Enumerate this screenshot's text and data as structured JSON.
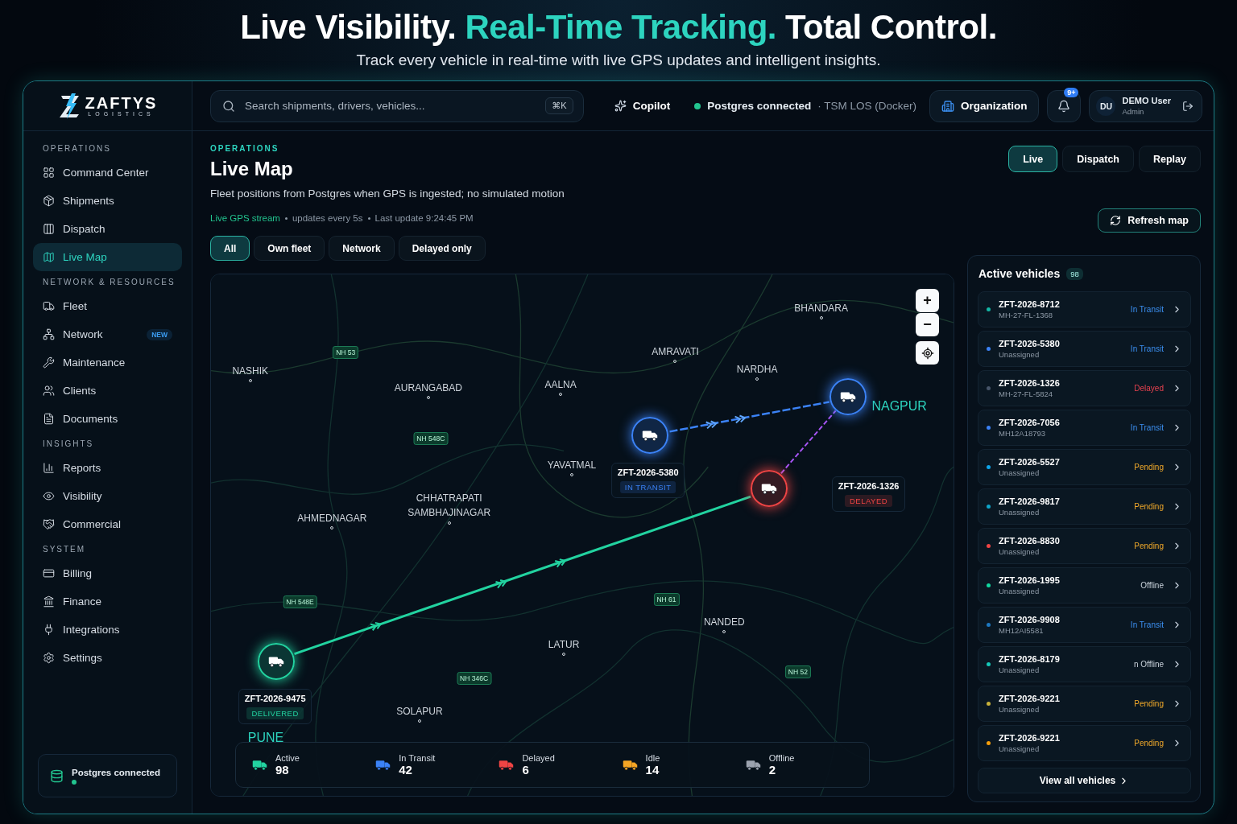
{
  "hero": {
    "headline": [
      {
        "text": "Live Visibility.",
        "highlight": false
      },
      {
        "text": "Real-Time Tracking.",
        "highlight": true
      },
      {
        "text": "Total Control.",
        "highlight": false
      }
    ],
    "subtitle": "Track every vehicle in real-time with live GPS updates and intelligent insights."
  },
  "brand": {
    "name": "ZAFTYS",
    "tagline": "LOGISTICS"
  },
  "sidebar": {
    "sections": [
      {
        "title": "OPERATIONS",
        "items": [
          {
            "label": "Command Center",
            "selected": false
          },
          {
            "label": "Shipments",
            "selected": false
          },
          {
            "label": "Dispatch",
            "selected": false
          },
          {
            "label": "Live Map",
            "selected": true
          }
        ]
      },
      {
        "title": "NETWORK & RESOURCES",
        "items": [
          {
            "label": "Fleet",
            "selected": false
          },
          {
            "label": "Network",
            "selected": false,
            "badge": "NEW"
          },
          {
            "label": "Maintenance",
            "selected": false
          },
          {
            "label": "Clients",
            "selected": false
          },
          {
            "label": "Documents",
            "selected": false
          }
        ]
      },
      {
        "title": "INSIGHTS",
        "items": [
          {
            "label": "Reports",
            "selected": false
          },
          {
            "label": "Visibility",
            "selected": false
          },
          {
            "label": "Commercial",
            "selected": false
          }
        ]
      },
      {
        "title": "SYSTEM",
        "items": [
          {
            "label": "Billing",
            "selected": false
          },
          {
            "label": "Finance",
            "selected": false
          },
          {
            "label": "Integrations",
            "selected": false
          },
          {
            "label": "Settings",
            "selected": false
          }
        ]
      }
    ],
    "footer": {
      "label": "Postgres connected",
      "online": true
    }
  },
  "top_bar": {
    "search": {
      "placeholder": "Search shipments, drivers, vehicles...",
      "shortcut": "⌘K"
    },
    "copilot": "Copilot",
    "db_status": {
      "label": "Postgres connected",
      "detail": "· TSM LOS (Docker)",
      "connected": true
    },
    "organization": "Organization",
    "notifications": "9+",
    "user": {
      "initials": "DU",
      "name": "DEMO User",
      "role": "Admin"
    }
  },
  "page": {
    "eyebrow": "OPERATIONS",
    "title": "Live Map",
    "description": "Fleet positions from Postgres when GPS is ingested; no simulated motion",
    "stream": {
      "label": "Live GPS stream",
      "interval": "updates every 5s",
      "last_update": "Last update 9:24:45 PM"
    },
    "filters": [
      {
        "label": "All",
        "selected": true
      },
      {
        "label": "Own fleet",
        "selected": false
      },
      {
        "label": "Network",
        "selected": false
      },
      {
        "label": "Delayed only",
        "selected": false
      }
    ],
    "modes": [
      {
        "label": "Live",
        "selected": true
      },
      {
        "label": "Dispatch",
        "selected": false
      },
      {
        "label": "Replay",
        "selected": false
      }
    ],
    "refresh": "Refresh map"
  },
  "map": {
    "zoom_in": "+",
    "zoom_out": "−",
    "cities": [
      {
        "name": "BHANDARA",
        "kind": "town"
      },
      {
        "name": "AMRAVATI",
        "kind": "town"
      },
      {
        "name": "NARDHA",
        "kind": "town"
      },
      {
        "name": "AALNA",
        "kind": "town"
      },
      {
        "name": "AURANGABAD",
        "kind": "town"
      },
      {
        "name": "NASHIK",
        "kind": "town"
      },
      {
        "name": "YAVATMAL",
        "kind": "town"
      },
      {
        "name": "CHHATRAPATI SAMBHAJINAGAR",
        "kind": "town"
      },
      {
        "name": "AHMEDNAGAR",
        "kind": "town"
      },
      {
        "name": "NANDED",
        "kind": "town"
      },
      {
        "name": "LATUR",
        "kind": "town"
      },
      {
        "name": "SOLAPUR",
        "kind": "town"
      },
      {
        "name": "NAGPUR",
        "kind": "hub"
      },
      {
        "name": "PUNE",
        "kind": "hub"
      }
    ],
    "roads": [
      "NH 53",
      "NH 548C",
      "NH 548E",
      "NH 61",
      "NH 346C",
      "NH 52"
    ],
    "vehicles": [
      {
        "kind": "in_transit"
      },
      {
        "id": "ZFT-2026-5380",
        "status": "IN TRANSIT",
        "kind": "in_transit"
      },
      {
        "id": "ZFT-2026-1326",
        "status": "DELAYED",
        "kind": "delayed"
      },
      {
        "id": "ZFT-2026-9475",
        "status": "DELIVERED",
        "kind": "delivered"
      }
    ],
    "stats": [
      {
        "label": "Active",
        "value": "98",
        "color": "#22d3a0"
      },
      {
        "label": "In Transit",
        "value": "42",
        "color": "#3b82f6"
      },
      {
        "label": "Delayed",
        "value": "6",
        "color": "#ef4444"
      },
      {
        "label": "Idle",
        "value": "14",
        "color": "#f5a524"
      },
      {
        "label": "Offline",
        "value": "2",
        "color": "#9ca3af"
      }
    ]
  },
  "vehicles_panel": {
    "title": "Active vehicles",
    "count": "98",
    "rows": [
      {
        "id": "ZFT-2026-8712",
        "plate": "MH-27-FL-1368",
        "status": "In Transit",
        "kind": "transit",
        "color": "#14b8a6"
      },
      {
        "id": "ZFT-2026-5380",
        "plate": "Unassigned",
        "status": "In Transit",
        "kind": "transit",
        "color": "#3b82f6"
      },
      {
        "id": "ZFT-2026-1326",
        "plate": "MH-27-FL-5824",
        "status": "Delayed",
        "kind": "delayed",
        "color": "#475569"
      },
      {
        "id": "ZFT-2026-7056",
        "plate": "MH12A18793",
        "status": "In Transit",
        "kind": "transit",
        "color": "#3b82f6"
      },
      {
        "id": "ZFT-2026-5527",
        "plate": "Unassigned",
        "status": "Pending",
        "kind": "pending",
        "color": "#0ea5e9"
      },
      {
        "id": "ZFT-2026-9817",
        "plate": "Unassigned",
        "status": "Pending",
        "kind": "pending",
        "color": "#0ea5c9"
      },
      {
        "id": "ZFT-2026-8830",
        "plate": "Unassigned",
        "status": "Pending",
        "kind": "pending",
        "color": "#ef4444"
      },
      {
        "id": "ZFT-2026-1995",
        "plate": "Unassigned",
        "status": "Offline",
        "kind": "offline",
        "color": "#10d9a0"
      },
      {
        "id": "ZFT-2026-9908",
        "plate": "MH12AI5581",
        "status": "In Transit",
        "kind": "transit",
        "color": "#1d78c1"
      },
      {
        "id": "ZFT-2026-8179",
        "plate": "Unassigned",
        "status": "n Offline",
        "kind": "offline",
        "color": "#14c8b8"
      },
      {
        "id": "ZFT-2026-9221",
        "plate": "Unassigned",
        "status": "Pending",
        "kind": "pending",
        "color": "#c9b23a"
      },
      {
        "id": "ZFT-2026-9221",
        "plate": "Unassigned",
        "status": "Pending",
        "kind": "pending",
        "color": "#f59e0b"
      }
    ],
    "view_all": "View all vehicles"
  }
}
